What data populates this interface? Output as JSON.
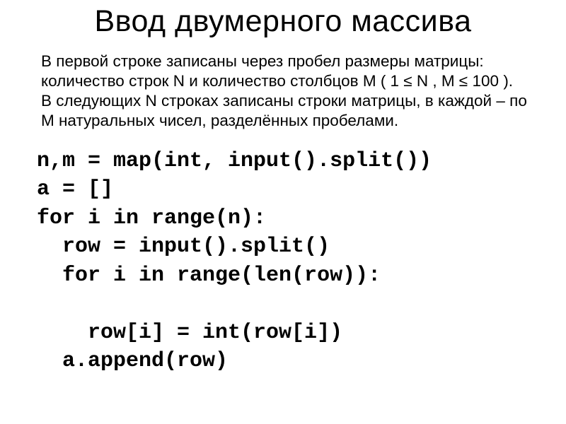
{
  "slide": {
    "title": "Ввод двумерного массива",
    "description": "В первой строке записаны через пробел размеры матрицы: количество строк N и количество столбцов M ( 1 ≤ N , M ≤ 100 ). В следующих N строках записаны строки матрицы, в каждой – по M натуральных чисел, разделённых пробелами.",
    "code": "n,m = map(int, input().split())\na = []\nfor i in range(n):\n  row = input().split()\n  for i in range(len(row)):\n\n    row[i] = int(row[i])\n  a.append(row)"
  }
}
